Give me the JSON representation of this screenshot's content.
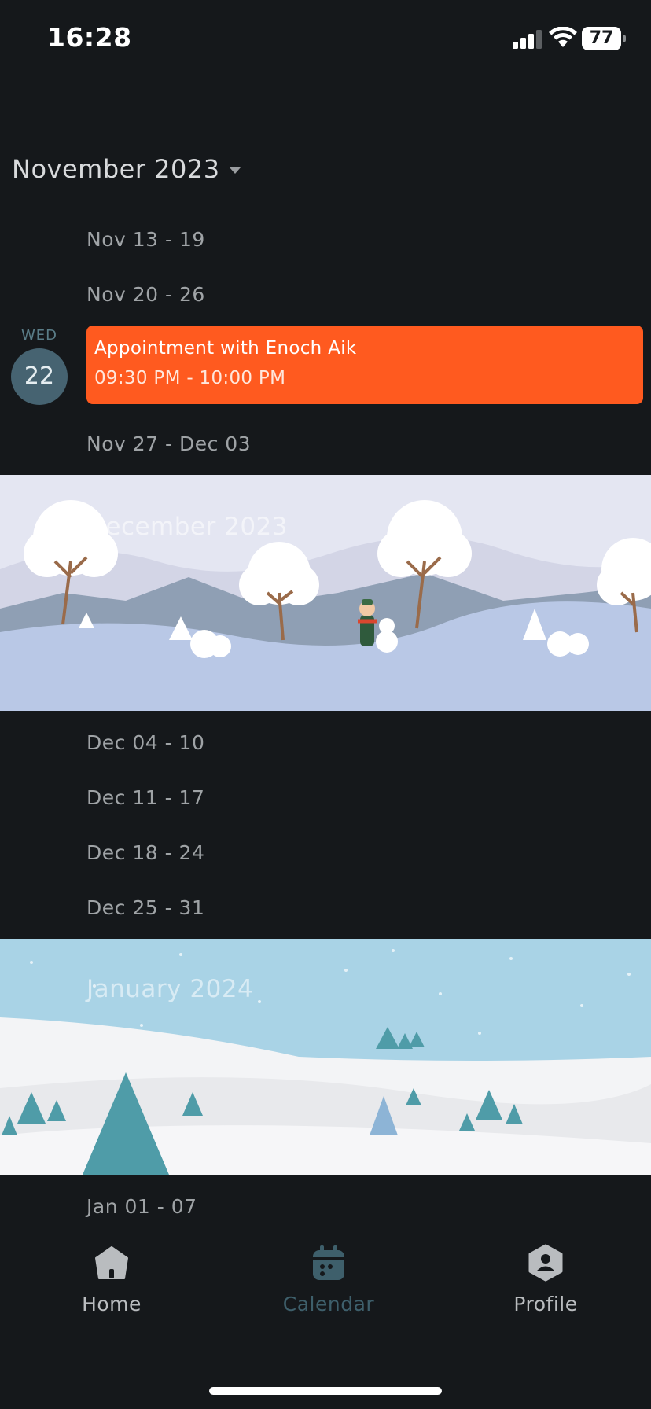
{
  "status_bar": {
    "time": "16:28",
    "battery": "77"
  },
  "calendar": {
    "month_title": "November 2023",
    "weeks_november": [
      "Nov 13 - 19",
      "Nov 20 - 26",
      "Nov 27 - Dec 03"
    ],
    "selected_day": {
      "weekday": "WED",
      "day": "22"
    },
    "event": {
      "title": "Appointment with Enoch Aik",
      "time": "09:30 PM - 10:00 PM",
      "color": "#ff5a1f"
    },
    "december_banner": {
      "title": "December 2023",
      "theme": "winter-snowman-illustration"
    },
    "weeks_december": [
      "Dec 04 - 10",
      "Dec 11 - 17",
      "Dec 18 - 24",
      "Dec 25 - 31"
    ],
    "january_banner": {
      "title": "January 2024",
      "theme": "snowy-pine-landscape-illustration"
    },
    "weeks_january": [
      "Jan 01 - 07"
    ]
  },
  "tab_bar": {
    "tabs": [
      {
        "label": "Home",
        "icon": "home-icon",
        "active": false
      },
      {
        "label": "Calendar",
        "icon": "calendar-icon",
        "active": true
      },
      {
        "label": "Profile",
        "icon": "profile-icon",
        "active": false
      }
    ],
    "active_color": "#3e5f6b",
    "inactive_color": "#b9bcbf"
  }
}
